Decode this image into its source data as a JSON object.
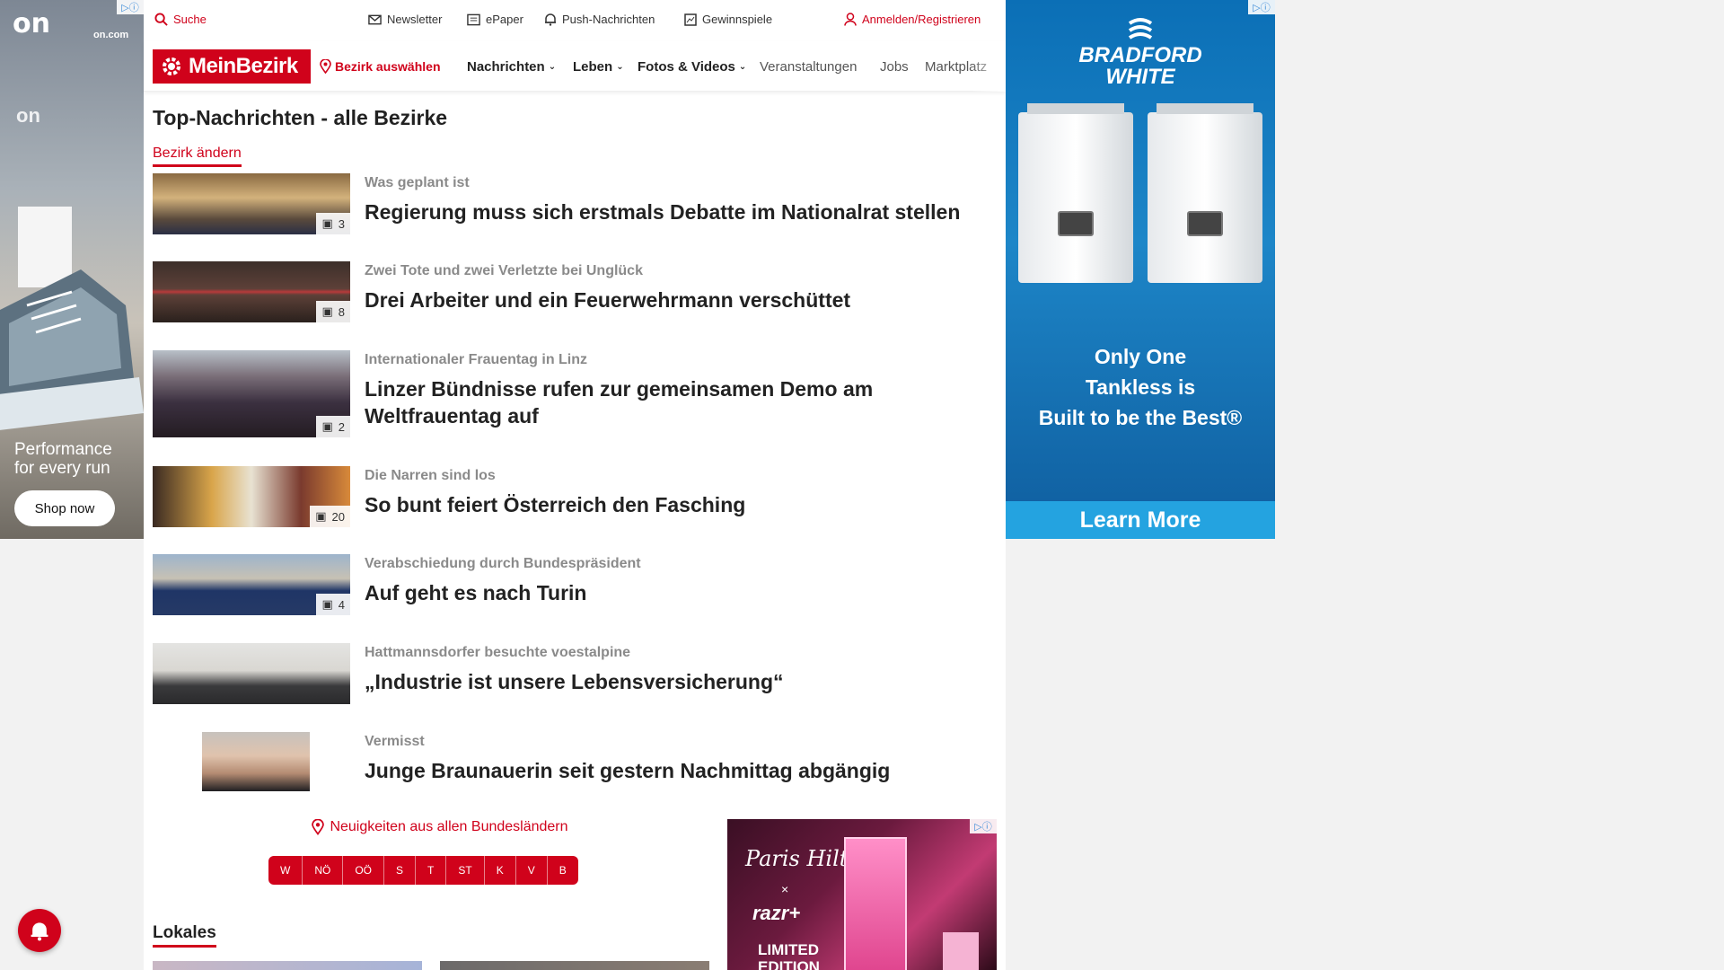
{
  "ad_left": {
    "brand": "on",
    "domain": "on.com",
    "tagline_1": "Performance",
    "tagline_2": "for every run",
    "cta": "Shop now"
  },
  "topbar": {
    "search": "Suche",
    "newsletter": "Newsletter",
    "epaper": "ePaper",
    "push": "Push-Nachrichten",
    "gewinnspiele": "Gewinnspiele",
    "login": "Anmelden/Registrieren"
  },
  "nav": {
    "logo": "MeinBezirk",
    "bezirk": "Bezirk auswählen",
    "items": [
      "Nachrichten",
      "Leben",
      "Fotos & Videos",
      "Veranstaltungen",
      "Jobs",
      "Marktplatz"
    ]
  },
  "section": {
    "title": "Top-Nachrichten - alle Bezirke",
    "change": "Bezirk ändern"
  },
  "articles": [
    {
      "kicker": "Was geplant ist",
      "headline": "Regierung muss sich erstmals Debatte im Nationalrat stellen",
      "count": "3"
    },
    {
      "kicker": "Zwei Tote und zwei Verletzte bei Unglück",
      "headline": "Drei Arbeiter und ein Feuerwehrmann verschüttet",
      "count": "8"
    },
    {
      "kicker": "Internationaler Frauentag in Linz",
      "headline": "Linzer Bündnisse rufen zur gemeinsamen Demo am Weltfrauentag auf",
      "count": "2"
    },
    {
      "kicker": "Die Narren sind los",
      "headline": "So bunt feiert Österreich den Fasching",
      "count": "20"
    },
    {
      "kicker": "Verabschiedung durch Bundespräsident",
      "headline": "Auf geht es nach Turin",
      "count": "4"
    },
    {
      "kicker": "Hattmannsdorfer besuchte voestalpine",
      "headline": "„Industrie ist unsere Lebensversicherung“",
      "count": ""
    },
    {
      "kicker": "Vermisst",
      "headline": "Junge Braunauerin seit gestern Nachmittag abgängig",
      "count": ""
    }
  ],
  "bundeslaender": {
    "title": "Neuigkeiten aus allen Bundesländern",
    "states": [
      "W",
      "NÖ",
      "OÖ",
      "S",
      "T",
      "ST",
      "K",
      "V",
      "B"
    ]
  },
  "lokales": {
    "title": "Lokales"
  },
  "ad_mid": {
    "script": "Paris Hilton",
    "x": "×",
    "razr": "razr+",
    "limited_1": "LIMITED",
    "limited_2": "EDITION"
  },
  "ad_right": {
    "brand_1": "BRADFORD",
    "brand_2": "WHITE",
    "copy_1": "Only One",
    "copy_2": "Tankless is",
    "copy_3": "Built to be the Best®",
    "cta": "Learn More"
  },
  "colors": {
    "accent": "#d0021b",
    "ad_blue": "#0b6fb6"
  }
}
